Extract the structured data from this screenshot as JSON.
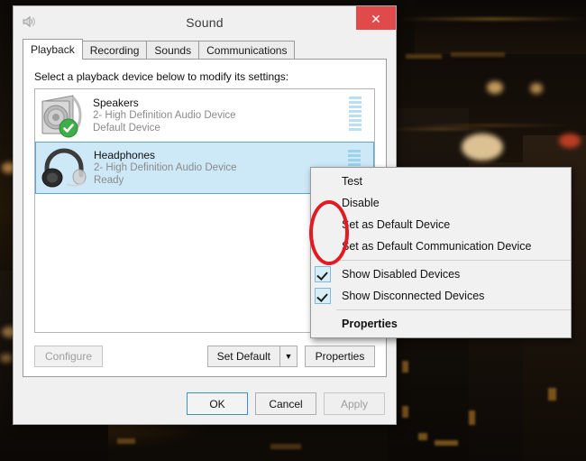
{
  "window": {
    "title": "Sound",
    "app_icon": "speaker-icon",
    "close_label": "✕",
    "close_color": "#e04a4a"
  },
  "tabs": [
    {
      "label": "Playback",
      "active": true
    },
    {
      "label": "Recording",
      "active": false
    },
    {
      "label": "Sounds",
      "active": false
    },
    {
      "label": "Communications",
      "active": false
    }
  ],
  "playback": {
    "prompt": "Select a playback device below to modify its settings:",
    "devices": [
      {
        "name": "Speakers",
        "driver": "2- High Definition Audio Device",
        "status": "Default Device",
        "icon": "speaker-box-icon",
        "badge": "green-check-badge",
        "selected": false,
        "meter_segments": 8,
        "meter_active": 0
      },
      {
        "name": "Headphones",
        "driver": "2- High Definition Audio Device",
        "status": "Ready",
        "icon": "headphones-icon",
        "badge": null,
        "selected": true,
        "meter_segments": 4,
        "meter_active": 0
      }
    ],
    "buttons": {
      "configure": "Configure",
      "configure_disabled": true,
      "set_default": "Set Default",
      "set_default_arrow": "▼",
      "properties": "Properties"
    }
  },
  "dialog_buttons": {
    "ok": "OK",
    "cancel": "Cancel",
    "apply": "Apply",
    "apply_disabled": true
  },
  "context_menu": {
    "items": [
      {
        "label": "Test",
        "checked": false,
        "bold": false,
        "separator_after": false
      },
      {
        "label": "Disable",
        "checked": false,
        "bold": false,
        "separator_after": false
      },
      {
        "label": "Set as Default Device",
        "checked": false,
        "bold": false,
        "separator_after": false
      },
      {
        "label": "Set as Default Communication Device",
        "checked": false,
        "bold": false,
        "separator_after": true
      },
      {
        "label": "Show Disabled Devices",
        "checked": true,
        "bold": false,
        "separator_after": false
      },
      {
        "label": "Show Disconnected Devices",
        "checked": true,
        "bold": false,
        "separator_after": true
      },
      {
        "label": "Properties",
        "checked": false,
        "bold": true,
        "separator_after": false
      }
    ]
  },
  "annotation": {
    "shape": "ellipse",
    "color": "#e01b22"
  },
  "colors": {
    "selection": "#cde8f7",
    "selection_border": "#5ba7d0",
    "default_badge": "#3fae49",
    "accent_close": "#e04a4a",
    "dialog_face": "#f0f0f0"
  }
}
